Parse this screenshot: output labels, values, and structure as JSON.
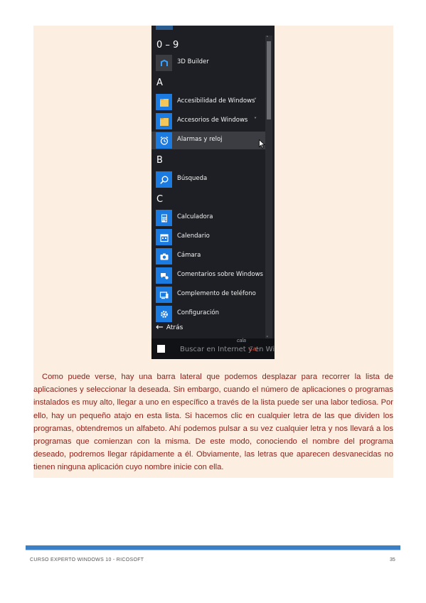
{
  "start_menu": {
    "sections": [
      {
        "letter": "0 – 9",
        "apps": [
          {
            "label": "3D Builder",
            "icon": "3d-builder-icon",
            "tile": "dark"
          }
        ]
      },
      {
        "letter": "A",
        "apps": [
          {
            "label": "Accesibilidad de Windows",
            "icon": "folder-icon",
            "expand": "˅"
          },
          {
            "label": "Accesorios de Windows",
            "icon": "folder-icon",
            "expand": "˅"
          },
          {
            "label": "Alarmas y reloj",
            "icon": "alarm-clock-icon",
            "hover": true
          }
        ]
      },
      {
        "letter": "B",
        "apps": [
          {
            "label": "Búsqueda",
            "icon": "search-icon"
          }
        ]
      },
      {
        "letter": "C",
        "apps": [
          {
            "label": "Calculadora",
            "icon": "calculator-icon"
          },
          {
            "label": "Calendario",
            "icon": "calendar-icon"
          },
          {
            "label": "Cámara",
            "icon": "camera-icon"
          },
          {
            "label": "Comentarios sobre Windows",
            "icon": "feedback-icon"
          },
          {
            "label": "Complemento de teléfono",
            "icon": "phone-icon"
          },
          {
            "label": "Configuración",
            "icon": "gear-icon"
          }
        ]
      }
    ],
    "back_label": "Atrás",
    "search_text": "Buscar en Internet y en Wi",
    "accent_color": "#1c7be0"
  },
  "watermark": {
    "line1": "cala",
    "line2": "Cal"
  },
  "paragraph": "Como puede verse, hay una barra lateral que podemos desplazar para recorrer la lista de aplicaciones y seleccionar la deseada. Sin embargo, cuando el número de aplicaciones o programas instalados es muy alto, llegar a uno en específico a través de la lista puede ser una labor tediosa. Por ello, hay un pequeño atajo en esta lista. Si hacemos clic en cualquier letra de las que dividen los programas, obtendremos un alfabeto. Ahí podemos pulsar a su vez cualquier letra y nos llevará a los programas que comienzan con la misma. De este modo, conociendo el nombre del programa deseado, podremos llegar rápidamente a él. Obviamente, las letras que aparecen desvanecidas no tienen ninguna aplicación cuyo nombre inicie con ella.",
  "footer": {
    "course": "CURSO EXPERTO WINDOWS 10 - RICOSOFT",
    "page_number": "35"
  }
}
